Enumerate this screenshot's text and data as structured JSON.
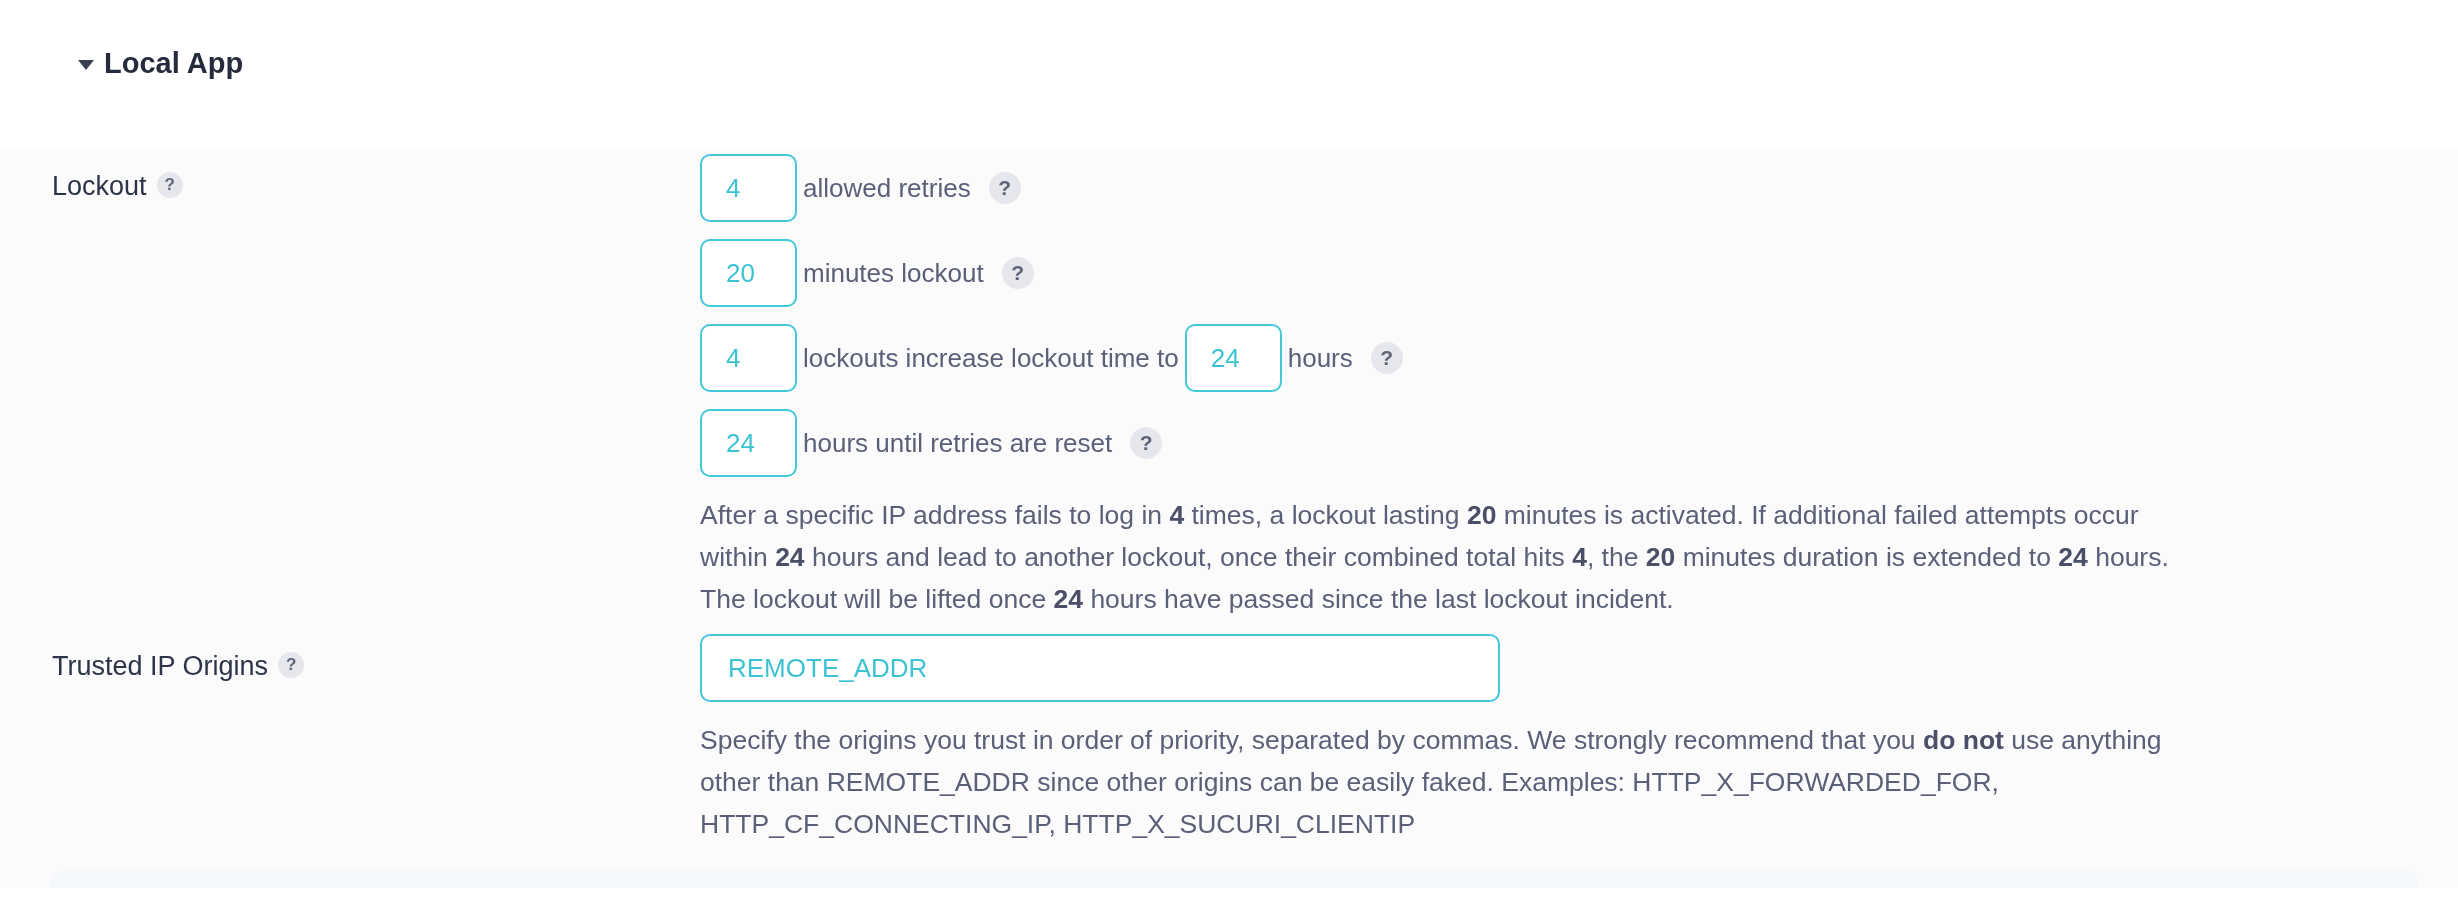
{
  "section": {
    "title": "Local App",
    "expanded": true
  },
  "fields": [
    {
      "label": "Lockout",
      "help": "?",
      "rows": [
        {
          "parts": [
            {
              "kind": "input",
              "value": "4"
            },
            {
              "kind": "text",
              "text": "allowed retries"
            },
            {
              "kind": "help",
              "text": "?"
            }
          ]
        },
        {
          "parts": [
            {
              "kind": "input",
              "value": "20"
            },
            {
              "kind": "text",
              "text": "minutes lockout"
            },
            {
              "kind": "help",
              "text": "?"
            }
          ]
        },
        {
          "parts": [
            {
              "kind": "input",
              "value": "4"
            },
            {
              "kind": "text",
              "text": "lockouts increase lockout time to"
            },
            {
              "kind": "input",
              "value": "24"
            },
            {
              "kind": "text",
              "text": "hours"
            },
            {
              "kind": "help",
              "text": "?"
            }
          ]
        },
        {
          "parts": [
            {
              "kind": "input",
              "value": "24"
            },
            {
              "kind": "text",
              "text": "hours until retries are reset"
            },
            {
              "kind": "help",
              "text": "?"
            }
          ]
        }
      ],
      "description": "After a specific IP address fails to log in **4** times, a lockout lasting **20** minutes is activated. If additional failed attempts occur within **24** hours and lead to another lockout, once their combined total hits **4**, the **20** minutes duration is extended to **24** hours. The lockout will be lifted once **24** hours have passed since the last lockout incident."
    },
    {
      "label": "Trusted IP Origins",
      "help": "?",
      "rows": [
        {
          "parts": [
            {
              "kind": "wide_input",
              "value": "REMOTE_ADDR"
            }
          ]
        }
      ],
      "description": "Specify the origins you trust in order of priority, separated by commas. We strongly recommend that you **do not** use anything other than REMOTE_ADDR since other origins can be easily faked. Examples: HTTP_X_FORWARDED_FOR, HTTP_CF_CONNECTING_IP, HTTP_X_SUCURI_CLIENTIP"
    }
  ]
}
